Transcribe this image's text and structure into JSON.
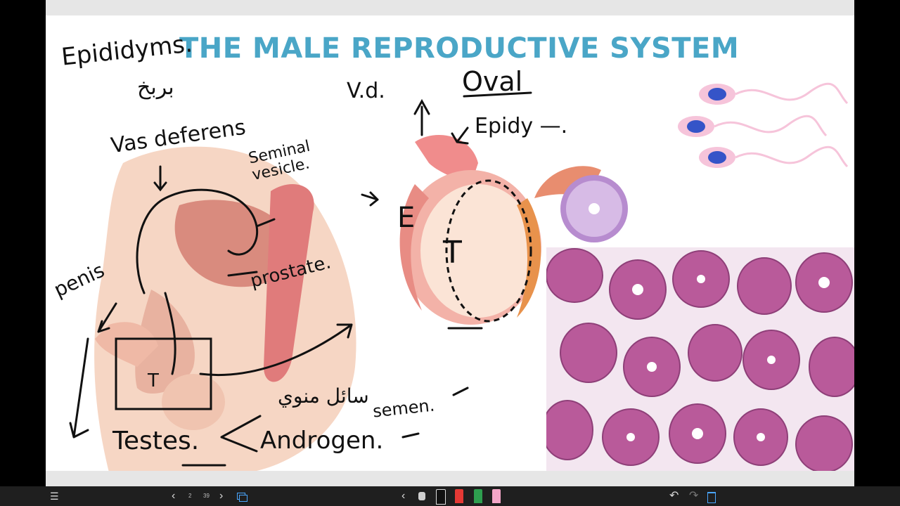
{
  "slide": {
    "title": "THE MALE REPRODUCTIVE SYSTEM",
    "labels": {
      "epididyms": "Epididyms.",
      "arabic_epididymis": "بربخ",
      "vas_deferens": "Vas deferens",
      "seminal_vesicle": "Seminal vesicle.",
      "penis": "penis",
      "prostate": "prostate.",
      "testes": "Testes.",
      "androgen": "Androgen.",
      "arabic_semen": "سائل منوي",
      "semen": "semen.",
      "vd": "V.d.",
      "oval": "Oval",
      "epidy": "Epidy —.",
      "letter_e": "E",
      "letter_t": "T",
      "letter_t_small": "T"
    }
  },
  "toolbar": {
    "menu_icon": "☰",
    "page_current": "2",
    "page_total": "39",
    "prev_icon": "‹",
    "next_icon": "›",
    "tool_prev_icon": "‹",
    "undo_icon": "↶",
    "redo_icon": "↷",
    "edit_icon": "✎"
  },
  "colors": {
    "title": "#4aa6c7",
    "pen_black": "#111111",
    "pen_red": "#e53935",
    "pen_green": "#2e9e4f",
    "pen_pink": "#f4a6c8",
    "toolbar_bg": "#1f1f1f",
    "histology": "#b95a9a"
  }
}
